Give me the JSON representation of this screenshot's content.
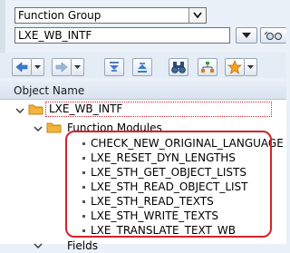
{
  "selector": {
    "type_value": "Function Group",
    "object_value": "LXE_WB_INTF"
  },
  "tree": {
    "header": "Object Name",
    "root": "LXE_WB_INTF",
    "folder": "Function Modules",
    "items": [
      "CHECK_NEW_ORIGINAL_LANGUAGE",
      "LXE_RESET_DYN_LENGTHS",
      "LXE_STH_GET_OBJECT_LISTS",
      "LXE_STH_READ_OBJECT_LIST",
      "LXE_STH_READ_TEXTS",
      "LXE_STH_WRITE_TEXTS",
      "LXE_TRANSLATE_TEXT_WB"
    ],
    "next_folder_partial": "Fields"
  },
  "colors": {
    "highlight": "#d1232a",
    "folder": "#f4b53c",
    "background": "#eaf1f8"
  },
  "icons": [
    "back-arrow-icon",
    "forward-arrow-icon",
    "expand-icon",
    "collapse-icon",
    "binoculars-icon",
    "hierarchy-icon",
    "favorites-star-icon",
    "dropdown-arrow-icon",
    "tree-toggle-icon",
    "folder-icon"
  ]
}
